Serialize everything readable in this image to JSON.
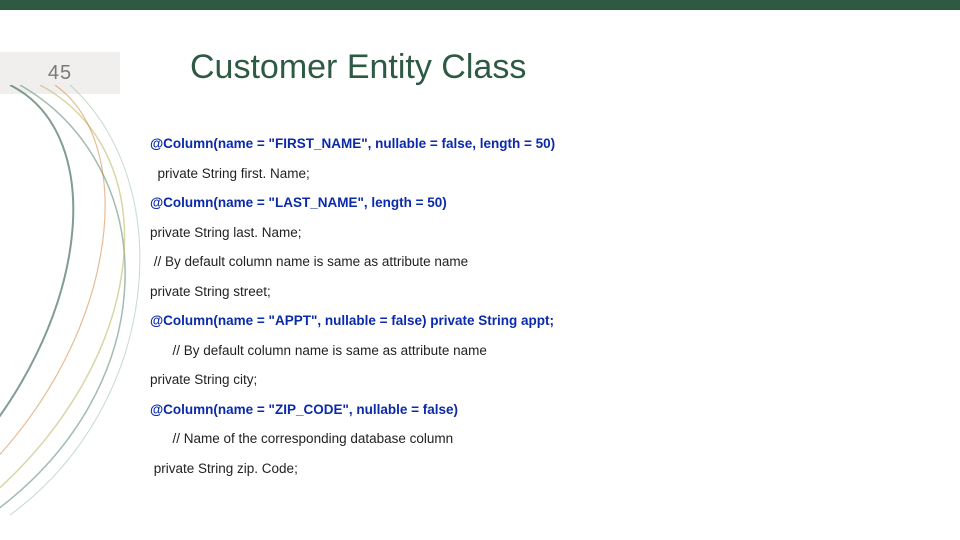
{
  "slide_number": "45",
  "title": "Customer Entity Class",
  "code_lines": [
    {
      "text": "@Column(name = \"FIRST_NAME\", nullable = false, length = 50)",
      "bold": true,
      "blue": true,
      "indent": 0
    },
    {
      "text": "  private String first. Name;",
      "bold": false,
      "blue": false,
      "indent": 0
    },
    {
      "text": "@Column(name = \"LAST_NAME\", length = 50)",
      "bold": true,
      "blue": true,
      "indent": 0
    },
    {
      "text": "private String last. Name;",
      "bold": false,
      "blue": false,
      "indent": 0
    },
    {
      "text": " // By default column name is same as attribute name",
      "bold": false,
      "blue": false,
      "indent": 0
    },
    {
      "text": "private String street;",
      "bold": false,
      "blue": false,
      "indent": 0
    },
    {
      "text": "@Column(name = \"APPT\", nullable = false) private String appt;",
      "bold": true,
      "blue": true,
      "indent": 0
    },
    {
      "text": "      // By default column name is same as attribute name",
      "bold": false,
      "blue": false,
      "indent": 0
    },
    {
      "text": "private String city;",
      "bold": false,
      "blue": false,
      "indent": 0
    },
    {
      "text": "@Column(name = \"ZIP_CODE\", nullable = false)",
      "bold": true,
      "blue": true,
      "indent": 0
    },
    {
      "text": "      // Name of the corresponding database column",
      "bold": false,
      "blue": false,
      "indent": 0
    },
    {
      "text": " private String zip. Code;",
      "bold": false,
      "blue": false,
      "indent": 0
    }
  ]
}
